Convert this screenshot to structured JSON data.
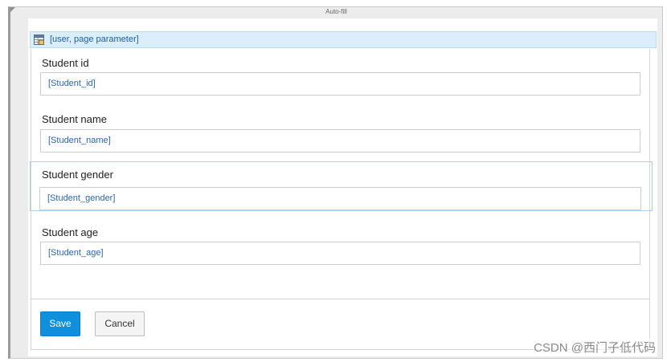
{
  "window": {
    "title": "Auto-fill"
  },
  "datasource": {
    "icon": "datasource-table-icon",
    "label": "[user, page parameter]"
  },
  "fields": [
    {
      "label": "Student id",
      "value": "[Student_id]"
    },
    {
      "label": "Student name",
      "value": "[Student_name]"
    },
    {
      "label": "Student gender",
      "value": "[Student_gender]"
    },
    {
      "label": "Student age",
      "value": "[Student_age]"
    }
  ],
  "buttons": {
    "save": "Save",
    "cancel": "Cancel"
  },
  "colors": {
    "accent": "#0f8fdc",
    "datasource_bg": "#dbeefb",
    "bound_text": "#2d65b0"
  },
  "watermark": "CSDN @西门子低代码"
}
